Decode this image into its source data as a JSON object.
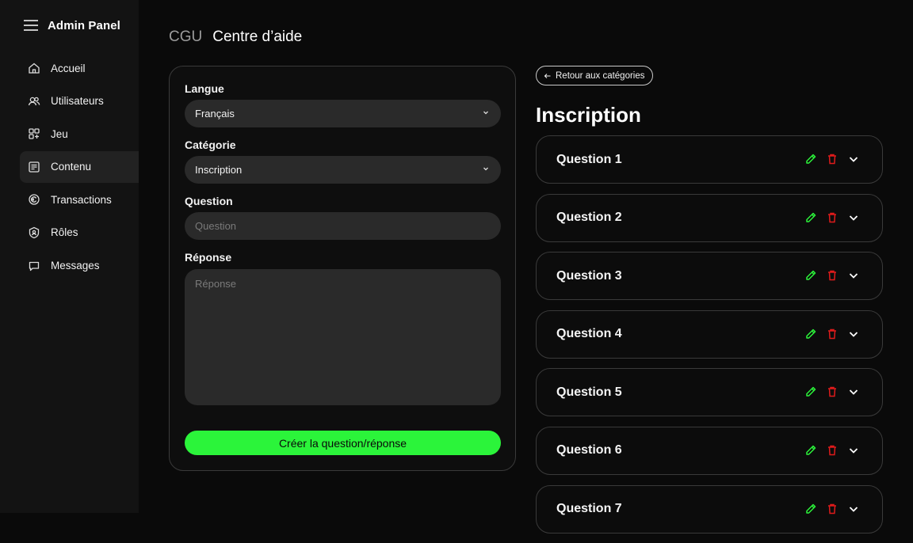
{
  "app": {
    "title": "Admin Panel"
  },
  "sidebar": {
    "items": [
      {
        "label": "Accueil",
        "icon": "home-icon"
      },
      {
        "label": "Utilisateurs",
        "icon": "users-icon"
      },
      {
        "label": "Jeu",
        "icon": "game-icon"
      },
      {
        "label": "Contenu",
        "icon": "content-icon",
        "active": true
      },
      {
        "label": "Transactions",
        "icon": "transactions-icon"
      },
      {
        "label": "Rôles",
        "icon": "roles-icon"
      },
      {
        "label": "Messages",
        "icon": "messages-icon"
      }
    ]
  },
  "breadcrumb": {
    "parent": "CGU",
    "current": "Centre d’aide"
  },
  "form": {
    "language_label": "Langue",
    "language_value": "Français",
    "category_label": "Catégorie",
    "category_value": "Inscription",
    "question_label": "Question",
    "question_placeholder": "Question",
    "answer_label": "Réponse",
    "answer_placeholder": "Réponse",
    "submit_label": "Créer la question/réponse"
  },
  "faq": {
    "back_label": "Retour aux catégories",
    "title": "Inscription",
    "questions": [
      {
        "label": "Question 1"
      },
      {
        "label": "Question 2"
      },
      {
        "label": "Question 3"
      },
      {
        "label": "Question 4"
      },
      {
        "label": "Question 5"
      },
      {
        "label": "Question 6"
      },
      {
        "label": "Question 7"
      }
    ]
  },
  "colors": {
    "accent": "#2bf43a",
    "edit": "#2bf43a",
    "delete": "#e01b1b",
    "background": "#0a0a0a",
    "sidebar": "#131313"
  }
}
